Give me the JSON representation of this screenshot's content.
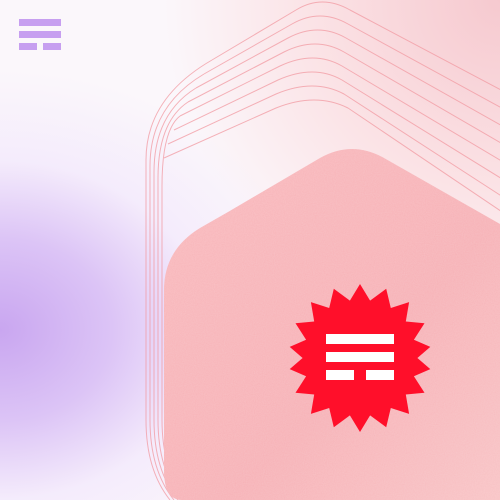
{
  "brand": {
    "logo_icon": "stacked-bars-logo-icon",
    "badge_icon": "starburst-seal-icon"
  },
  "colors": {
    "logo_purple": "#c79ff0",
    "seal_red": "#ff0f2a",
    "card_pink": "#f7b2b6",
    "outline_pink": "#f29aa2",
    "glow_purple": "#c9a6f0"
  }
}
